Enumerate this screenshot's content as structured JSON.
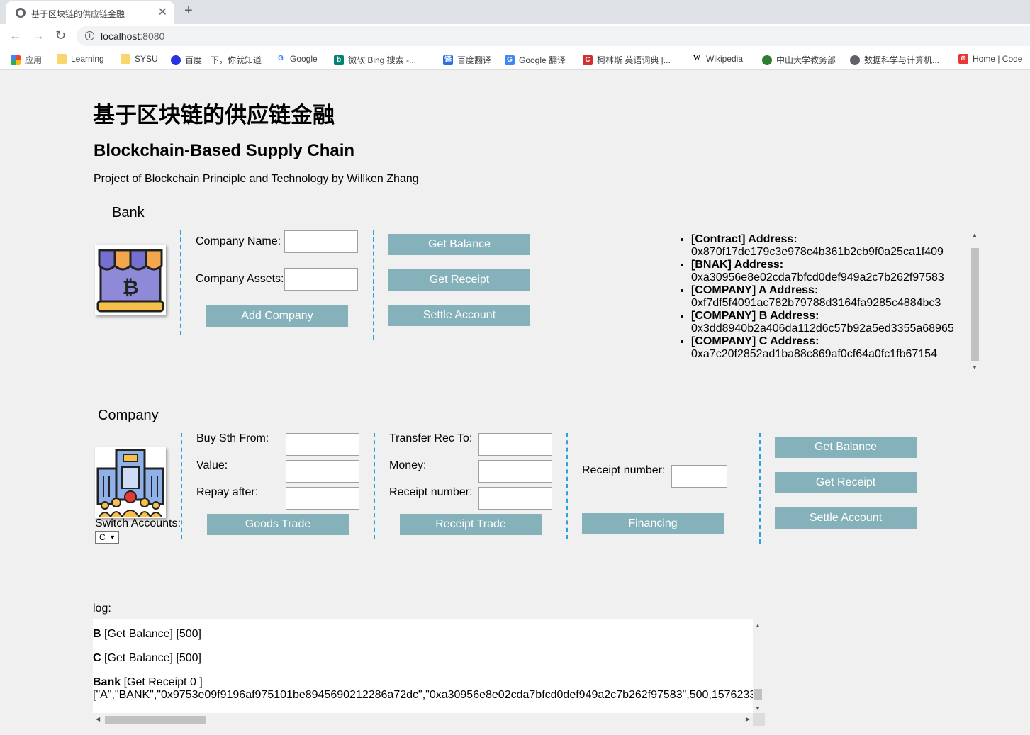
{
  "browser": {
    "tab_title": "基于区块链的供应链金融",
    "url_host": "localhost",
    "url_port": ":8080",
    "bookmarks": [
      {
        "label": "应用",
        "icon": "apps-grid-icon",
        "color": "#e53935"
      },
      {
        "label": "Learning",
        "icon": "folder-icon",
        "color": "#f9d56e"
      },
      {
        "label": "SYSU",
        "icon": "folder-icon",
        "color": "#f9d56e"
      },
      {
        "label": "百度一下，你就知道",
        "icon": "baidu-icon",
        "color": "#2932e1"
      },
      {
        "label": "Google",
        "icon": "google-icon",
        "color": "#4285f4"
      },
      {
        "label": "微软 Bing 搜索 -...",
        "icon": "bing-icon",
        "color": "#008373"
      },
      {
        "label": "百度翻译",
        "icon": "baidu-translate-icon",
        "color": "#2a6fe8"
      },
      {
        "label": "Google 翻译",
        "icon": "google-translate-icon",
        "color": "#4285f4"
      },
      {
        "label": "柯林斯 英语词典 |...",
        "icon": "collins-icon",
        "color": "#d32f2f"
      },
      {
        "label": "Wikipedia",
        "icon": "wikipedia-icon",
        "color": "#000000"
      },
      {
        "label": "中山大学教务部",
        "icon": "sysu-icon",
        "color": "#2e7d32"
      },
      {
        "label": "数据科学与计算机...",
        "icon": "globe-icon",
        "color": "#5f6368"
      },
      {
        "label": "Home | Code",
        "icon": "code-icon",
        "color": "#e53935"
      }
    ]
  },
  "page": {
    "title_cn": "基于区块链的供应链金融",
    "title_en": "Blockchain-Based Supply Chain",
    "subtitle": "Project of Blockchain Principle and Technology by Willken Zhang"
  },
  "bank": {
    "section_title": "Bank",
    "company_name_label": "Company Name:",
    "company_assets_label": "Company Assets:",
    "add_company_label": "Add Company",
    "get_balance_label": "Get Balance",
    "get_receipt_label": "Get Receipt",
    "settle_account_label": "Settle Account"
  },
  "addresses": [
    {
      "name": "[Contract] Address:",
      "value": "0x870f17de179c3e978c4b361b2cb9f0a25ca1f409"
    },
    {
      "name": "[BNAK] Address:",
      "value": "0xa30956e8e02cda7bfcd0def949a2c7b262f97583"
    },
    {
      "name": "[COMPANY] A Address:",
      "value": "0xf7df5f4091ac782b79788d3164fa9285c4884bc3"
    },
    {
      "name": "[COMPANY] B Address:",
      "value": "0x3dd8940b2a406da112d6c57b92a5ed3355a68965"
    },
    {
      "name": "[COMPANY] C Address:",
      "value": "0xa7c20f2852ad1ba88c869af0cf64a0fc1fb67154"
    }
  ],
  "company": {
    "section_title": "Company",
    "switch_accounts_label": "Switch Accounts:",
    "switch_accounts_value": "C",
    "buy_from_label": "Buy Sth From:",
    "value_label": "Value:",
    "repay_after_label": "Repay after:",
    "goods_trade_label": "Goods Trade",
    "transfer_to_label": "Transfer Rec To:",
    "money_label": "Money:",
    "receipt_number_label": "Receipt number:",
    "receipt_trade_label": "Receipt Trade",
    "financing_receipt_label": "Receipt number:",
    "financing_label": "Financing",
    "get_balance_label": "Get Balance",
    "get_receipt_label": "Get Receipt",
    "settle_account_label": "Settle Account"
  },
  "log": {
    "label": "log:",
    "entries": [
      {
        "who": "B",
        "text": " [Get Balance] [500]"
      },
      {
        "who": "C",
        "text": " [Get Balance] [500]"
      },
      {
        "who": "Bank",
        "text": " [Get Receipt 0 ]"
      }
    ],
    "receipt_line": "[\"A\",\"BANK\",\"0x9753e09f9196af975101be8945690212286a72dc\",\"0xa30956e8e02cda7bfcd0def949a2c7b262f97583\",500,1576233"
  },
  "colors": {
    "button": "#84b1ba",
    "divider": "#29a3e0"
  }
}
